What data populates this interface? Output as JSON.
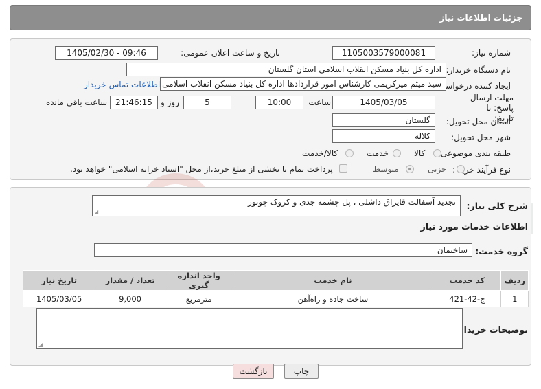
{
  "header": {
    "title": "جزئیات اطلاعات نیاز"
  },
  "form": {
    "need_number_label": "شماره نیاز:",
    "need_number": "1105003579000081",
    "announce_label": "تاریخ و ساعت اعلان عمومی:",
    "announce_value": "1405/02/30 - 09:46",
    "buyer_org_label": "نام دستگاه خریدار:",
    "buyer_org": "اداره کل بنیاد مسکن انقلاب اسلامی استان گلستان",
    "creator_label": "ایجاد کننده درخواست:",
    "creator": "سید میثم میرکریمی کارشناس امور قراردادها اداره کل بنیاد مسکن انقلاب اسلامی استان گلستان",
    "contact_link": "اطلاعات تماس خریدار",
    "deadline_label": "مهلت ارسال پاسخ: تا تاریخ:",
    "deadline_date": "1405/03/05",
    "time_label": "ساعت",
    "deadline_time": "10:00",
    "days_value": "5",
    "days_label": "روز و",
    "remaining_time": "21:46:15",
    "remaining_label": "ساعت باقی مانده",
    "province_label": "استان محل تحویل:",
    "province": "گلستان",
    "city_label": "شهر محل تحویل:",
    "city": "کلاله",
    "category_label": "طبقه بندی موضوعی:",
    "category_options": [
      "کالا",
      "خدمت",
      "کالا/خدمت"
    ],
    "purchase_type_label": "نوع فرآیند خرید :",
    "purchase_options": [
      "جزیی",
      "متوسط"
    ],
    "payment_note": "پرداخت تمام یا بخشی از مبلغ خرید،از محل \"اسناد خزانه اسلامی\" خواهد بود."
  },
  "details": {
    "summary_label": "شرح کلی نیاز:",
    "summary": "تجدید آسفالت قایراق داشلی ، پل چشمه جدی و کروک چوتور",
    "services_heading": "اطلاعات خدمات مورد نیاز",
    "service_group_label": "گروه خدمت:",
    "service_group": "ساختمان",
    "table": {
      "headers": [
        "ردیف",
        "کد خدمت",
        "نام خدمت",
        "واحد اندازه گیری",
        "تعداد / مقدار",
        "تاریخ نیاز"
      ],
      "rows": [
        [
          "1",
          "ج-42-421",
          "ساخت جاده و راه‌آهن",
          "مترمربع",
          "9,000",
          "1405/03/05"
        ]
      ]
    },
    "buyer_notes_label": "توضیحات خریدار:",
    "buyer_notes": ""
  },
  "buttons": {
    "print": "چاپ",
    "back": "بازگشت"
  },
  "colors": {
    "header": "#8e8e8e",
    "link": "#1f5fb4",
    "back_button": "#f6dede"
  },
  "watermark": {
    "text": "AriaTender.neT"
  }
}
